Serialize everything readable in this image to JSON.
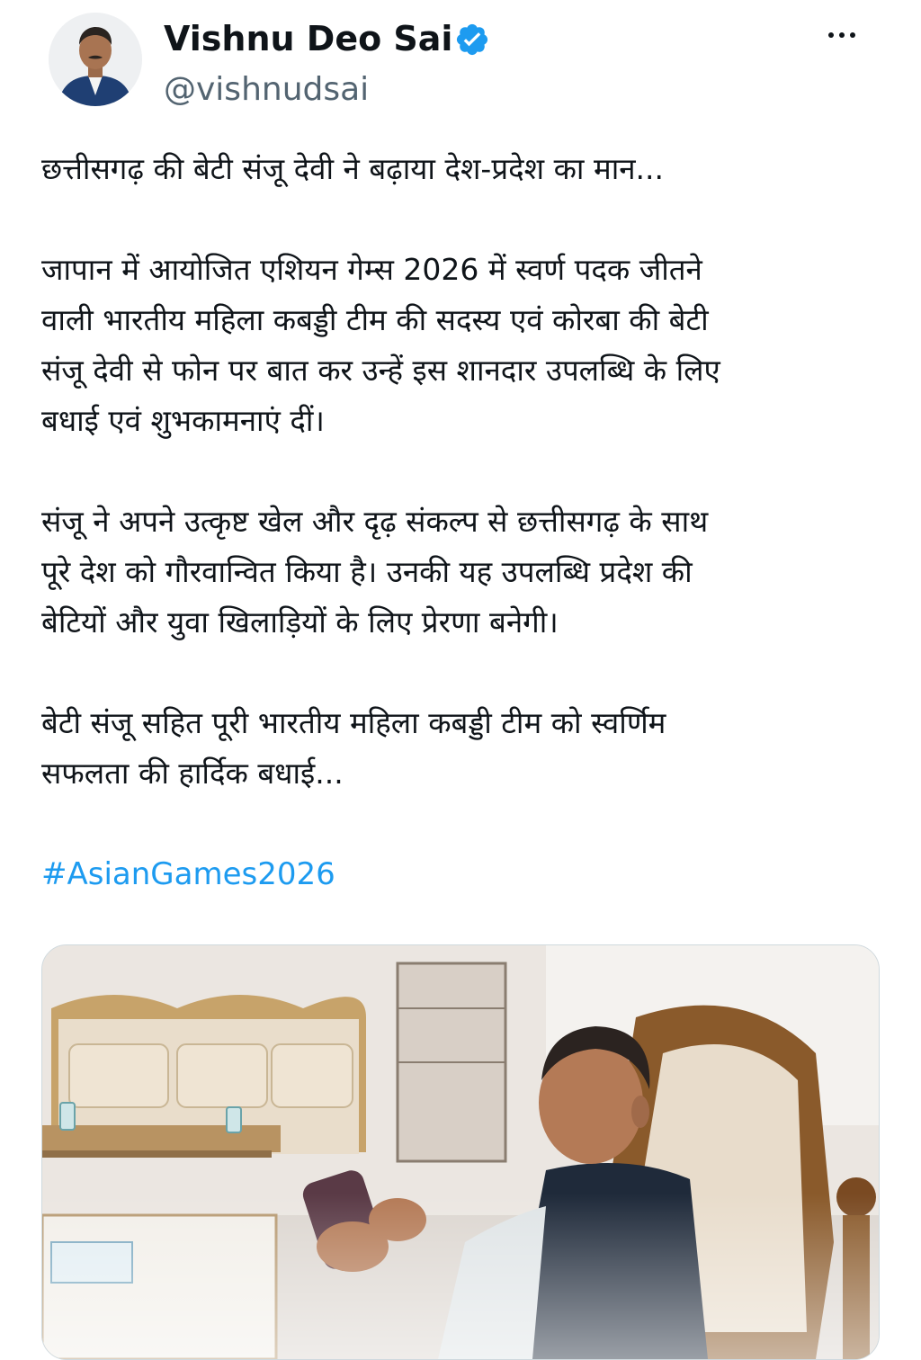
{
  "profile": {
    "display_name": "Vishnu Deo Sai",
    "handle": "@vishnudsai",
    "verified_icon": "verified-badge-icon",
    "avatar_icon": "avatar"
  },
  "actions": {
    "more_icon": "more-horizontal-icon"
  },
  "tweet": {
    "paragraphs": [
      "छत्तीसगढ़ की बेटी संजू देवी ने बढ़ाया देश-प्रदेश का मान...",
      "जापान में आयोजित एशियन गेम्स 2026 में स्वर्ण पदक जीतने\nवाली भारतीय महिला कबड्डी टीम की सदस्य एवं कोरबा की बेटी\nसंजू देवी से फोन पर बात कर उन्हें इस शानदार उपलब्धि के लिए\nबधाई एवं शुभकामनाएं दीं।",
      "संजू ने अपने उत्कृष्ट खेल और दृढ़ संकल्प से छत्तीसगढ़ के साथ\nपूरे देश को गौरवान्वित किया है। उनकी यह उपलब्धि प्रदेश की\nबेटियों और युवा खिलाड़ियों के लिए प्रेरणा बनेगी।",
      "बेटी संजू सहित पूरी भारतीय महिला कबड्डी टीम को स्वर्णिम\nसफलता की हार्दिक बधाई..."
    ],
    "hashtag": "#AsianGames2026"
  },
  "colors": {
    "text": "#0f1419",
    "secondary": "#536471",
    "accent": "#1d9bf0",
    "border": "#cfd9de"
  }
}
